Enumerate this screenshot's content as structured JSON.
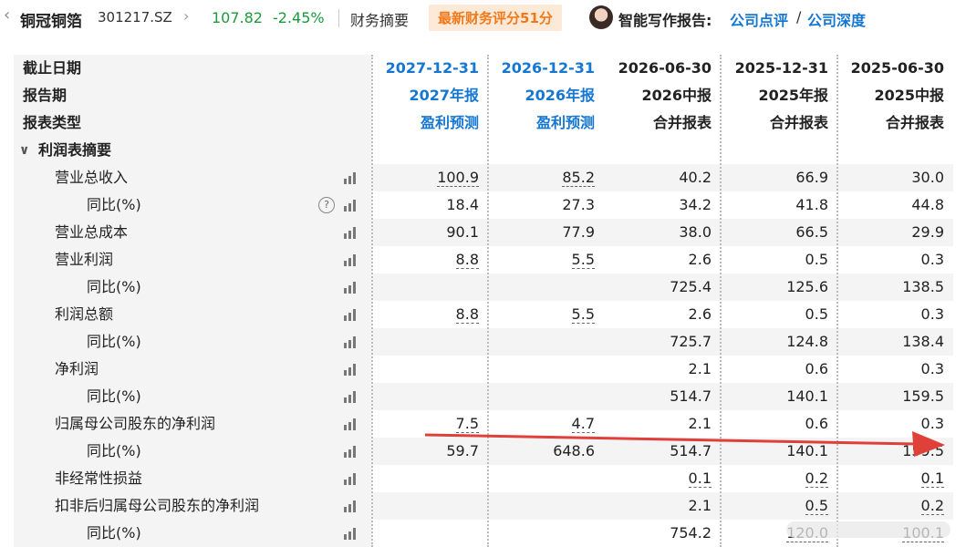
{
  "header": {
    "back_icon": "chevron-left-icon",
    "stock_name": "铜冠铜箔",
    "stock_code": "301217.SZ",
    "chevron": "›",
    "price": "107.82",
    "change": "-2.45%",
    "summary_label": "财务摘要",
    "score_badge": "最新财务评分51分",
    "ai_label": "智能写作报告:",
    "link_review": "公司点评",
    "separator": "/",
    "link_depth": "公司深度",
    "price_color": "#1a9a3c",
    "link_color": "#1677d2"
  },
  "table": {
    "header_rows": [
      {
        "label": "截止日期",
        "cells": [
          "2027-12-31",
          "2026-12-31",
          "2026-06-30",
          "2025-12-31",
          "2025-06-30"
        ]
      },
      {
        "label": "报告期",
        "cells": [
          "2027年报",
          "2026年报",
          "2026中报",
          "2025年报",
          "2025中报"
        ]
      },
      {
        "label": "报表类型",
        "cells": [
          "盈利预测",
          "盈利预测",
          "合并报表",
          "合并报表",
          "合并报表"
        ]
      }
    ],
    "section_title": "利润表摘要",
    "section_toggle": "∨",
    "rows": [
      {
        "label": "营业总收入",
        "values": [
          "100.9",
          "85.2",
          "40.2",
          "66.9",
          "30.0"
        ]
      },
      {
        "label": "同比(%)",
        "values": [
          "18.4",
          "27.3",
          "34.2",
          "41.8",
          "44.8"
        ],
        "help": "?"
      },
      {
        "label": "营业总成本",
        "values": [
          "90.1",
          "77.9",
          "38.0",
          "66.5",
          "29.9"
        ]
      },
      {
        "label": "营业利润",
        "values": [
          "8.8",
          "5.5",
          "2.6",
          "0.5",
          "0.3"
        ]
      },
      {
        "label": "同比(%)",
        "values": [
          "",
          "",
          "725.4",
          "125.6",
          "138.5"
        ]
      },
      {
        "label": "利润总额",
        "values": [
          "8.8",
          "5.5",
          "2.6",
          "0.5",
          "0.3"
        ]
      },
      {
        "label": "同比(%)",
        "values": [
          "",
          "",
          "725.7",
          "124.8",
          "138.4"
        ]
      },
      {
        "label": "净利润",
        "values": [
          "",
          "",
          "2.1",
          "0.6",
          "0.3"
        ]
      },
      {
        "label": "同比(%)",
        "values": [
          "",
          "",
          "514.7",
          "140.1",
          "159.5"
        ]
      },
      {
        "label": "归属母公司股东的净利润",
        "values": [
          "7.5",
          "4.7",
          "2.1",
          "0.6",
          "0.3"
        ]
      },
      {
        "label": "同比(%)",
        "values": [
          "59.7",
          "648.6",
          "514.7",
          "140.1",
          "159.5"
        ]
      },
      {
        "label": "非经常性损益",
        "values": [
          "",
          "",
          "0.1",
          "0.2",
          "0.1"
        ]
      },
      {
        "label": "扣非后归属母公司股东的净利润",
        "values": [
          "",
          "",
          "2.1",
          "0.5",
          "0.2"
        ]
      },
      {
        "label": "同比(%)",
        "values": [
          "",
          "",
          "754.2",
          "120.0",
          "100.1"
        ]
      }
    ],
    "chart_icon": "bar-chart-icon"
  },
  "annotation": {
    "arrow_color": "#e0403a"
  }
}
